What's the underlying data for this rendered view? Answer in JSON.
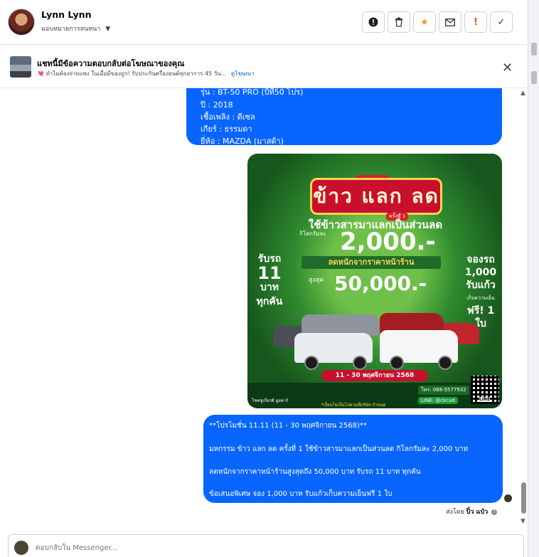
{
  "header": {
    "contact_name": "Lynn Lynn",
    "assign_label": "มอบหมายการสนทนา",
    "actions": [
      {
        "name": "mark-spam-button",
        "icon": "!"
      },
      {
        "name": "delete-button",
        "icon": "🗑"
      },
      {
        "name": "star-button",
        "icon": "★"
      },
      {
        "name": "mark-unread-button",
        "icon": "✉"
      },
      {
        "name": "follow-up-button",
        "icon": "!"
      },
      {
        "name": "mark-done-button",
        "icon": "✓"
      }
    ]
  },
  "ad_banner": {
    "title": "แชทนี้มีข้อความตอบกลับต่อโฆษณาของคุณ",
    "description": "💘 ทำไมต้องจ่ายแพง ในเมื่อมีของถูก! รับประกันครื่องยนต์ทุกอาการ 45 วัน...",
    "link": "ดูโฆษณา"
  },
  "messages": {
    "car_details": [
      "รุ่น : BT-50 PRO (บีที50 โปร)",
      "ปี : 2018",
      "เชื้อเพลิง : ดีเซล",
      "เกียร์ : ธรรมดา",
      "ยี่ห้อ : MAZDA (มาสด้า)"
    ],
    "promo_text": [
      "**โปรโมชั่น 11.11  (11 - 30 พฤศจิกายน 2568)**",
      "มหกรรม ข้าว แลก ลด ครั้งที่ 1 ใช้ข้าวสารมาแลกเป็นส่วนลด กิโลกรัมละ 2,000 บาท",
      "ลดหนักจากราคาหน้าร้านสูงสุดถึง 50,000 บาท รับรถ 11 บาท ทุกคัน",
      "ข้อเสนอพิเศษ จอง 1,000 บาท รับแก้วเก็บความเย็นฟรี 1 ใบ"
    ],
    "sent_by_prefix": "ส่งโดย",
    "sent_by_name": "ปิ๋ว แป๋ว"
  },
  "promo_image": {
    "tag": "มหกรรม",
    "marquee": "ข้าว แลก ลด",
    "round": "ครั้งที่ 1",
    "headline": "ใช้ข้าวสารมาแลกเป็นส่วนลด",
    "per_kg": "กิโลกรัมละ",
    "amount1": "2,000.-",
    "left_line1": "รับรถ",
    "left_number": "11",
    "left_line2": "บาท",
    "left_line3": "ทุกคัน",
    "discount_banner": "ลดหนักจากราคาหน้าร้าน",
    "up_to": "สูงสุด",
    "amount2": "50,000.-",
    "right_line1": "จองรถ",
    "right_line2": "1,000",
    "right_line3": "รับแก้ว",
    "right_small": "เก็บความเย็น",
    "right_line4": "ฟรี! 1 ใบ",
    "date_range": "11 - 30 พฤศจิกายน 2568",
    "footer_note": "*เงื่อนไขเป็นไปตามที่บริษัท กำหนด",
    "footer_brand": "โชคชูเกียรติ ยูสคาร์",
    "tel": "โทร: 088-5577932",
    "line": "LINE: @ckcud",
    "qr_label": "LINE"
  },
  "composer": {
    "placeholder": "ตอบกลับใน Messenger..."
  },
  "colors": {
    "bubble": "#0866ff",
    "link": "#0064d1",
    "star": "#f7923a"
  }
}
